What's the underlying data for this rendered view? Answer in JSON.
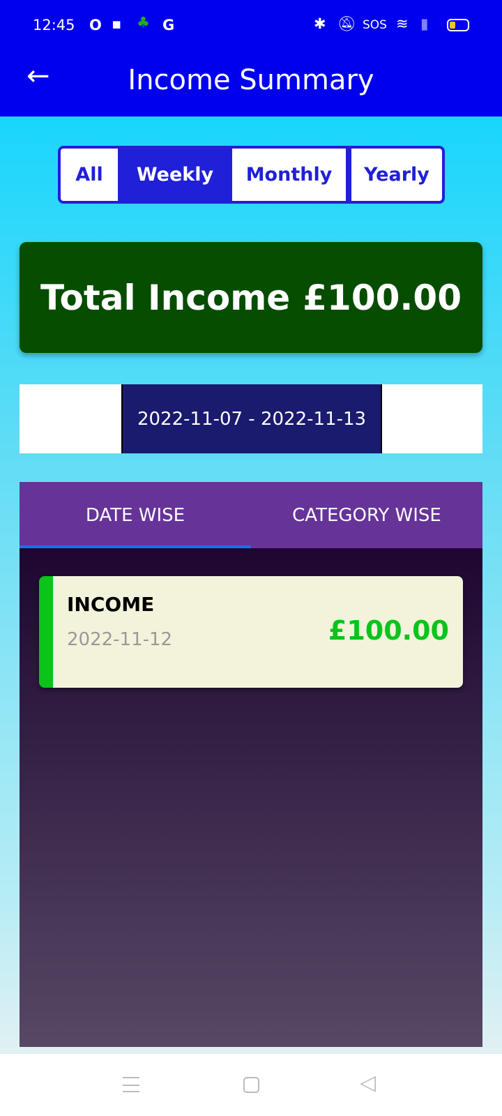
{
  "status_bar": {
    "time": "12:45",
    "indicators": [
      "O",
      "G"
    ],
    "sos": "SOS",
    "icons": [
      "bluetooth-icon",
      "mute-icon",
      "wifi-icon",
      "signal-icon",
      "battery-icon"
    ]
  },
  "header": {
    "title": "Income Summary",
    "back_icon": "arrow-left-icon"
  },
  "period_tabs": [
    {
      "label": "All",
      "selected": false
    },
    {
      "label": "Weekly",
      "selected": true
    },
    {
      "label": "Monthly",
      "selected": false
    },
    {
      "label": "Yearly",
      "selected": false
    }
  ],
  "total": {
    "label": "Total Income",
    "amount": "£100.00"
  },
  "date_range": "2022-11-07 - 2022-11-13",
  "view_tabs": [
    {
      "label": "DATE WISE",
      "selected": true
    },
    {
      "label": "CATEGORY WISE",
      "selected": false
    }
  ],
  "entries": [
    {
      "title": "INCOME",
      "date": "2022-11-12",
      "amount": "£100.00"
    }
  ],
  "colors": {
    "appbar": "#0000ee",
    "accent": "#2020d8",
    "total_card": "#074d00",
    "income_green": "#0ac41a",
    "tabs": "#663399"
  }
}
